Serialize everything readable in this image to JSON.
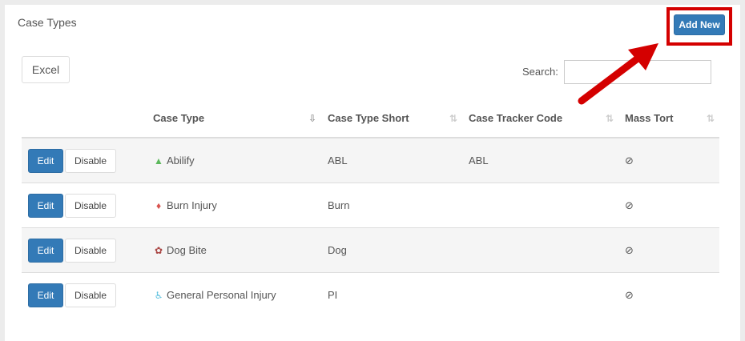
{
  "panel": {
    "title": "Case Types"
  },
  "toolbar": {
    "add_new_label": "Add New",
    "excel_label": "Excel",
    "search_label": "Search:",
    "search_value": ""
  },
  "table": {
    "headers": [
      "Case Type",
      "Case Type Short",
      "Case Tracker Code",
      "Mass Tort"
    ],
    "rows": [
      {
        "edit": "Edit",
        "disable": "Disable",
        "icon": "flask-icon",
        "icon_color": "#5cb85c",
        "case_type": "Abilify",
        "short": "ABL",
        "tracker_code": "ABL",
        "mass_tort": "ban-icon"
      },
      {
        "edit": "Edit",
        "disable": "Disable",
        "icon": "fire-icon",
        "icon_color": "#d9534f",
        "case_type": "Burn Injury",
        "short": "Burn",
        "tracker_code": "",
        "mass_tort": "ban-icon"
      },
      {
        "edit": "Edit",
        "disable": "Disable",
        "icon": "paw-icon",
        "icon_color": "#a94442",
        "case_type": "Dog Bite",
        "short": "Dog",
        "tracker_code": "",
        "mass_tort": "ban-icon"
      },
      {
        "edit": "Edit",
        "disable": "Disable",
        "icon": "wheelchair-icon",
        "icon_color": "#5bc0de",
        "case_type": "General Personal Injury",
        "short": "PI",
        "tracker_code": "",
        "mass_tort": "ban-icon"
      }
    ]
  },
  "colors": {
    "primary": "#337ab7",
    "highlight": "#d40000"
  }
}
